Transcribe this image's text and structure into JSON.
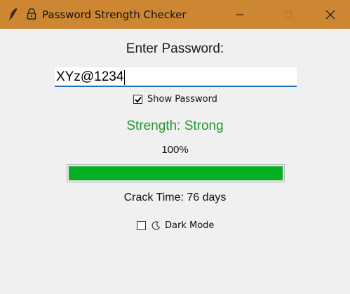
{
  "window": {
    "title": "Password Strength Checker",
    "app_icon": "feather-icon",
    "lock_icon": "lock-icon",
    "titlebar_color": "#cd8733"
  },
  "form": {
    "prompt": "Enter Password:",
    "password_value": "XYz@1234",
    "show_password_label": "Show Password",
    "show_password_checked": true
  },
  "result": {
    "strength_text": "Strength: Strong",
    "strength_color": "#1f9a2a",
    "percent_text": "100%",
    "progress_fraction": 1.0,
    "progress_color": "#06b025",
    "crack_time_text": "Crack Time: 76 days"
  },
  "options": {
    "dark_mode_label": "Dark Mode",
    "dark_mode_checked": false,
    "dark_mode_icon": "moon-icon"
  }
}
